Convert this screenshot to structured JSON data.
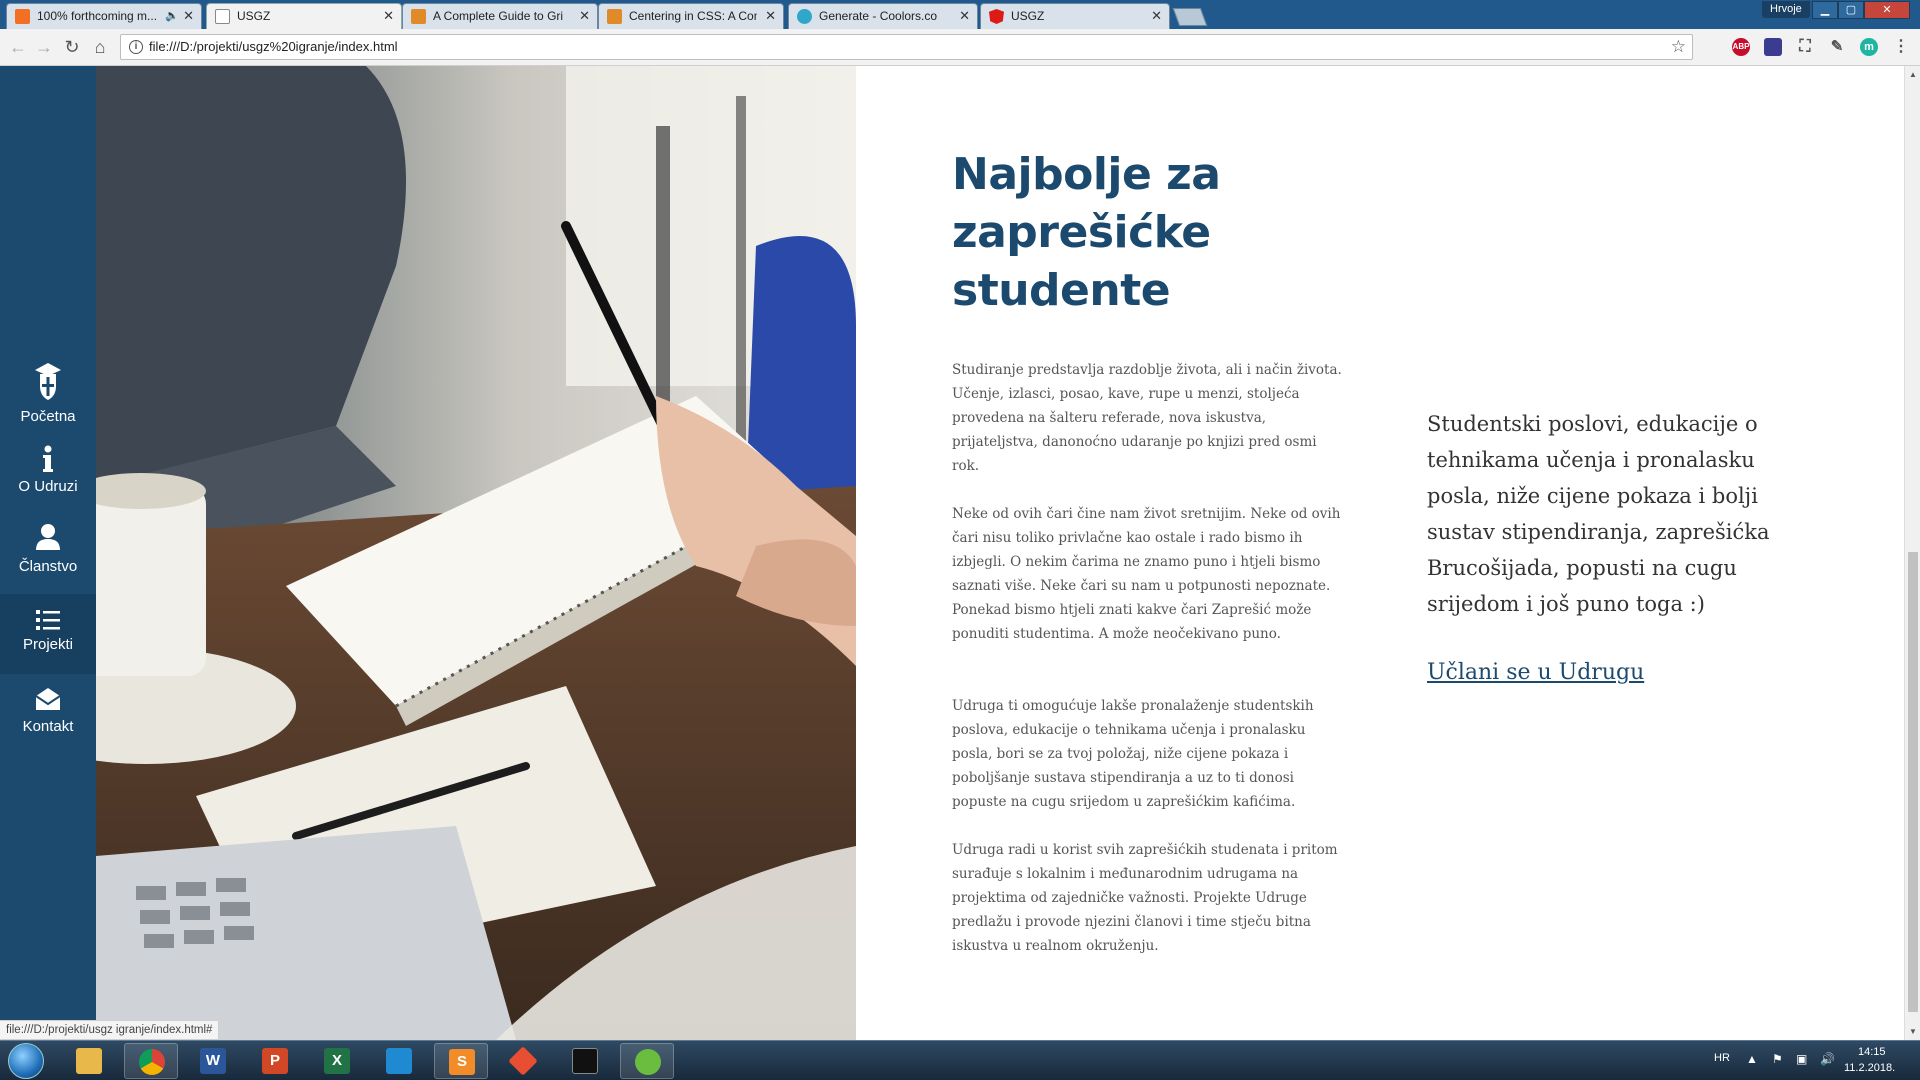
{
  "browser": {
    "tabs": [
      {
        "title": "100% forthcoming m...",
        "favicon": "soundcloud-icon",
        "color": "#f26f23"
      },
      {
        "title": "USGZ",
        "favicon": "page-icon",
        "color": "#ffffff"
      },
      {
        "title": "A Complete Guide to Gri",
        "favicon": "css-tricks-icon",
        "color": "#e08a2a"
      },
      {
        "title": "Centering in CSS: A Com",
        "favicon": "css-tricks-icon",
        "color": "#e08a2a"
      },
      {
        "title": "Generate - Coolors.co",
        "favicon": "coolors-icon",
        "color": "#2ea7c9"
      },
      {
        "title": "USGZ",
        "favicon": "angular-icon",
        "color": "#dd1b16"
      }
    ],
    "active_tab": 1,
    "profile_name": "Hrvoje",
    "url": "file:///D:/projekti/usgz%20igranje/index.html",
    "status_url": "file:///D:/projekti/usgz igranje/index.html#",
    "extensions": [
      {
        "name": "adblock-plus-icon",
        "label": "ABP",
        "color": "#c70d2c"
      },
      {
        "name": "extension-icon",
        "label": "",
        "color": "#3b3b8f"
      },
      {
        "name": "screenshot-icon",
        "label": "",
        "color": "#555555"
      },
      {
        "name": "eyedropper-icon",
        "label": "",
        "color": "#555555"
      },
      {
        "name": "m-extension-icon",
        "label": "m",
        "color": "#1fb5a3"
      }
    ]
  },
  "site": {
    "nav": [
      {
        "label": "Početna",
        "icon": "graduation-shield-icon"
      },
      {
        "label": "O Udruzi",
        "icon": "info-icon"
      },
      {
        "label": "Članstvo",
        "icon": "user-icon"
      },
      {
        "label": "Projekti",
        "icon": "list-icon"
      },
      {
        "label": "Kontakt",
        "icon": "envelope-icon"
      }
    ],
    "active_nav": 3,
    "title": "Najbolje za zaprešićke studente",
    "paragraphs": [
      "Studiranje predstavlja razdoblje života, ali i način života. Učenje, izlasci, posao, kave, rupe u menzi, stoljeća provedena na šalteru referade, nova iskustva, prijateljstva, danonoćno udaranje po knjizi pred osmi rok.",
      "Neke od ovih čari čine nam život sretnijim. Neke od ovih čari nisu toliko privlačne kao ostale i rado bismo ih izbjegli. O nekim čarima ne znamo puno i htjeli bismo saznati više. Neke čari su nam u potpunosti nepoznate. Ponekad bismo htjeli znati kakve čari Zaprešić može ponuditi studentima. A može neočekivano puno.",
      "Udruga ti omogućuje lakše pronalaženje studentskih poslova, edukacije o tehnikama učenja i pronalasku posla, bori se za tvoj položaj, niže cijene pokaza i poboljšanje sustava stipendiranja a uz to ti donosi popuste na cugu srijedom u zaprešićkim kafićima.",
      "Udruga radi u korist svih zaprešićkih studenata i pritom surađuje s lokalnim i međunarodnim udrugama na projektima od zajedničke važnosti. Projekte Udruge predlažu i provode njezini članovi i time stječu bitna iskustva u realnom okruženju."
    ],
    "side_text": "Studentski poslovi, edukacije o tehnikama učenja i pronalasku posla, niže cijene pokaza i bolji sustav stipendiranja, zaprešićka Brucošijada, popusti na cugu srijedom i još puno toga :)",
    "join_link": "Učlani se u Udrugu",
    "colors": {
      "brand": "#1c4a6e",
      "brand_dark": "#173f5f"
    }
  },
  "taskbar": {
    "apps": [
      {
        "name": "file-explorer-icon",
        "label": "",
        "color": "#e8b84a"
      },
      {
        "name": "chrome-icon",
        "label": "",
        "color": "#2f9c4a"
      },
      {
        "name": "word-icon",
        "label": "W",
        "color": "#2b579a"
      },
      {
        "name": "powerpoint-icon",
        "label": "P",
        "color": "#d24726"
      },
      {
        "name": "excel-icon",
        "label": "X",
        "color": "#217346"
      },
      {
        "name": "vscode-icon",
        "label": "",
        "color": "#1f8ad2"
      },
      {
        "name": "sublime-icon",
        "label": "S",
        "color": "#f28c28"
      },
      {
        "name": "git-icon",
        "label": "",
        "color": "#e84e31"
      },
      {
        "name": "terminal-icon",
        "label": "",
        "color": "#111111"
      },
      {
        "name": "utorrent-icon",
        "label": "",
        "color": "#6bbd3f"
      }
    ],
    "lang": "HR",
    "time": "14:15",
    "date": "11.2.2018."
  }
}
